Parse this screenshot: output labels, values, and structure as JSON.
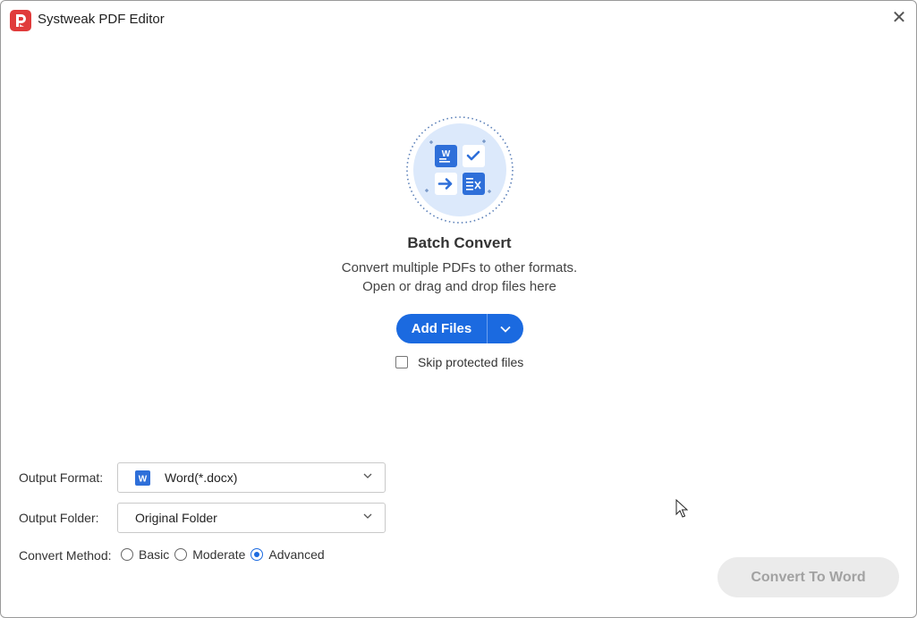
{
  "app": {
    "title": "Systweak PDF Editor",
    "close": "✕"
  },
  "colors": {
    "accent": "#1b6ae0",
    "disabled_bg": "#ebebeb",
    "disabled_text": "#a2a2a2",
    "brand_red": "#e03b3b"
  },
  "main": {
    "heading": "Batch Convert",
    "description_line1": "Convert multiple PDFs to other formats.",
    "description_line2": "Open or drag and drop files here",
    "add_files_label": "Add Files",
    "skip_protected_label": "Skip protected files",
    "skip_protected_checked": false
  },
  "form": {
    "output_format_label": "Output Format:",
    "output_format_value": "Word(*.docx)",
    "output_folder_label": "Output Folder:",
    "output_folder_value": "Original Folder",
    "convert_method_label": "Convert Method:",
    "methods": [
      {
        "label": "Basic",
        "selected": false
      },
      {
        "label": "Moderate",
        "selected": false
      },
      {
        "label": "Advanced",
        "selected": true
      }
    ]
  },
  "footer": {
    "convert_label": "Convert To Word",
    "convert_enabled": false
  }
}
